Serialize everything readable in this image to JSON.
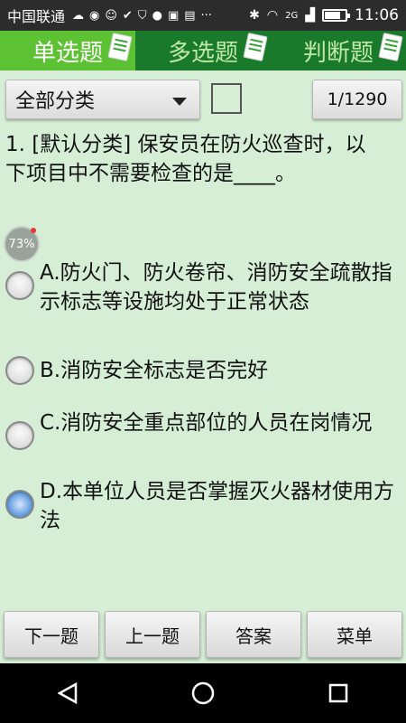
{
  "status_bar": {
    "carrier": "中国联通",
    "network": "2G",
    "time": "11:06",
    "battery_level": 0.75,
    "icons": [
      "cloud-icon",
      "app-icon",
      "smile-icon",
      "check-icon",
      "shield-icon",
      "bird-icon",
      "image-icon",
      "sms-icon",
      "more-icon",
      "bluetooth-icon",
      "wifi-icon",
      "signal-icon",
      "battery-icon"
    ]
  },
  "tabs": [
    {
      "label": "单选题",
      "active": true
    },
    {
      "label": "多选题",
      "active": false
    },
    {
      "label": "判断题",
      "active": false
    }
  ],
  "filter": {
    "category": "全部分类",
    "checked": false,
    "counter": "1/1290"
  },
  "question": {
    "text": "1. [默认分类] 保安员在防火巡查时，以下项目中不需要检查的是____。"
  },
  "progress_bubble": {
    "text": "73%"
  },
  "options": [
    {
      "text": "A.防火门、防火卷帘、消防安全疏散指示标志等设施均处于正常状态"
    },
    {
      "text": "B.消防安全标志是否完好"
    },
    {
      "text": "C.消防安全重点部位的人员在岗情况"
    },
    {
      "text": "D.本单位人员是否掌握灭火器材使用方法"
    }
  ],
  "bottom_buttons": {
    "next": "下一题",
    "prev": "上一题",
    "answer": "答案",
    "menu": "菜单"
  },
  "colors": {
    "tab_bar": "#1a7a2c",
    "tab_active": "#5cc233",
    "content_bg": "#d5eed5"
  }
}
